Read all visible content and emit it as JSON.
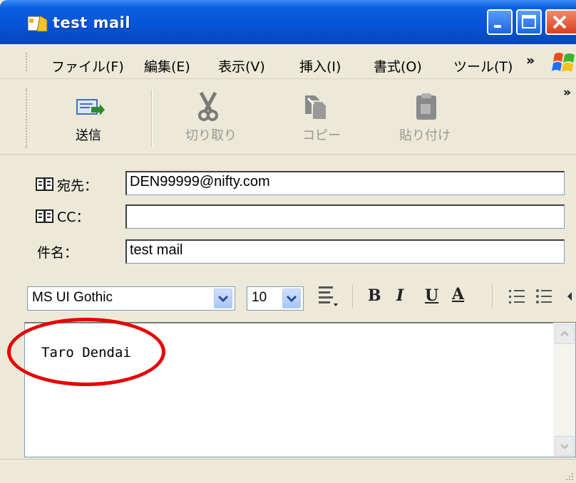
{
  "window": {
    "title": "test mail"
  },
  "menu": {
    "items": [
      "ファイル(F)",
      "編集(E)",
      "表示(V)",
      "挿入(I)",
      "書式(O)",
      "ツール(T)"
    ],
    "overflow": "»"
  },
  "toolbar": {
    "send": "送信",
    "cut": "切り取り",
    "copy": "コピー",
    "paste": "貼り付け",
    "overflow": "»"
  },
  "fields": {
    "to_label": "宛先：",
    "to_value": "DEN99999@nifty.com",
    "cc_label": "CC：",
    "cc_value": "",
    "subject_label": "件名：",
    "subject_value": "test mail"
  },
  "format": {
    "font": "MS UI Gothic",
    "size": "10",
    "bold": "B",
    "italic": "I",
    "underline": "U",
    "font_color": "A"
  },
  "body": {
    "text": "Taro Dendai"
  },
  "colors": {
    "titlebar": "#0553d6",
    "highlight_ellipse": "#e80000"
  }
}
